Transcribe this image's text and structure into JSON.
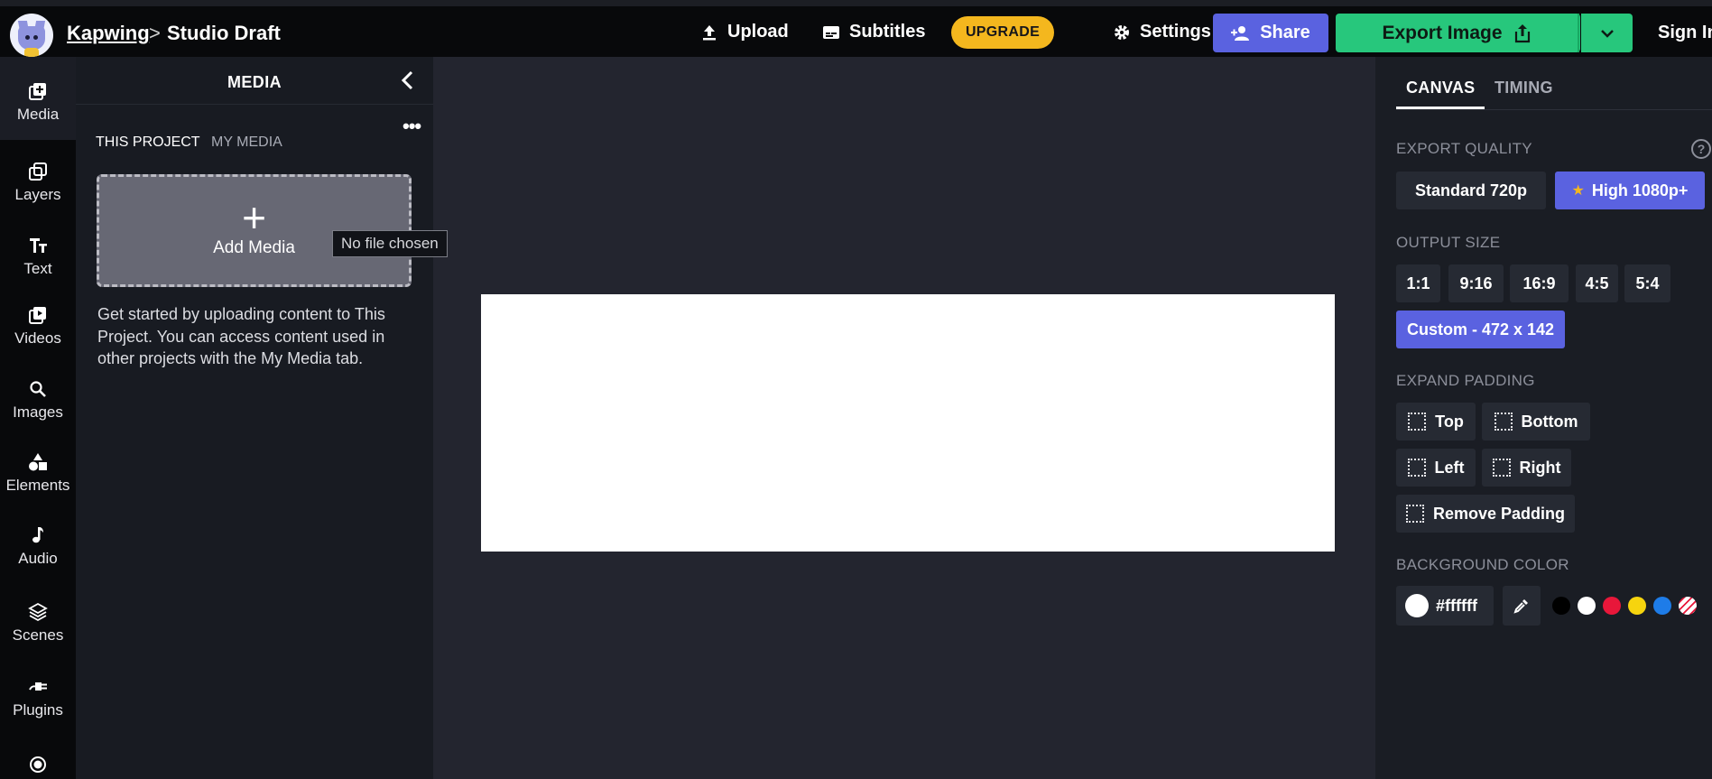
{
  "header": {
    "brand": "Kapwing",
    "separator": ">",
    "project": "Studio Draft",
    "upload": "Upload",
    "subtitles": "Subtitles",
    "upgrade": "UPGRADE",
    "settings": "Settings",
    "share": "Share",
    "export": "Export Image",
    "signin": "Sign In"
  },
  "rail": {
    "items": [
      {
        "label": "Media",
        "icon": "plus-square-icon"
      },
      {
        "label": "Layers",
        "icon": "layers-icon"
      },
      {
        "label": "Text",
        "icon": "text-icon"
      },
      {
        "label": "Videos",
        "icon": "video-icon"
      },
      {
        "label": "Images",
        "icon": "search-icon"
      },
      {
        "label": "Elements",
        "icon": "shapes-icon"
      },
      {
        "label": "Audio",
        "icon": "music-note-icon"
      },
      {
        "label": "Scenes",
        "icon": "stack-icon"
      },
      {
        "label": "Plugins",
        "icon": "plug-icon"
      }
    ]
  },
  "media_panel": {
    "title": "MEDIA",
    "tab_project": "THIS PROJECT",
    "tab_my_media": "MY MEDIA",
    "add_media": "Add Media",
    "file_tooltip": "No file chosen",
    "hint": "Get started by uploading content to This Project. You can access content used in other projects with the My Media tab."
  },
  "right_panel": {
    "tab_canvas": "CANVAS",
    "tab_timing": "TIMING",
    "export_quality": {
      "heading": "EXPORT QUALITY",
      "standard": "Standard 720p",
      "high": "High 1080p+"
    },
    "output_size": {
      "heading": "OUTPUT SIZE",
      "options": [
        "1:1",
        "9:16",
        "16:9",
        "4:5",
        "5:4"
      ],
      "custom": "Custom - 472 x 142"
    },
    "expand_padding": {
      "heading": "EXPAND PADDING",
      "top": "Top",
      "bottom": "Bottom",
      "left": "Left",
      "right": "Right",
      "remove": "Remove Padding"
    },
    "background": {
      "heading": "BACKGROUND COLOR",
      "value": "#ffffff",
      "swatches": [
        "#000000",
        "#ffffff",
        "#e8173a",
        "#f6d40e",
        "#1e7ce8"
      ]
    }
  },
  "colors": {
    "accent_blue": "#5a62e0",
    "export_green": "#27c77c",
    "upgrade_yellow": "#f4b71e"
  }
}
